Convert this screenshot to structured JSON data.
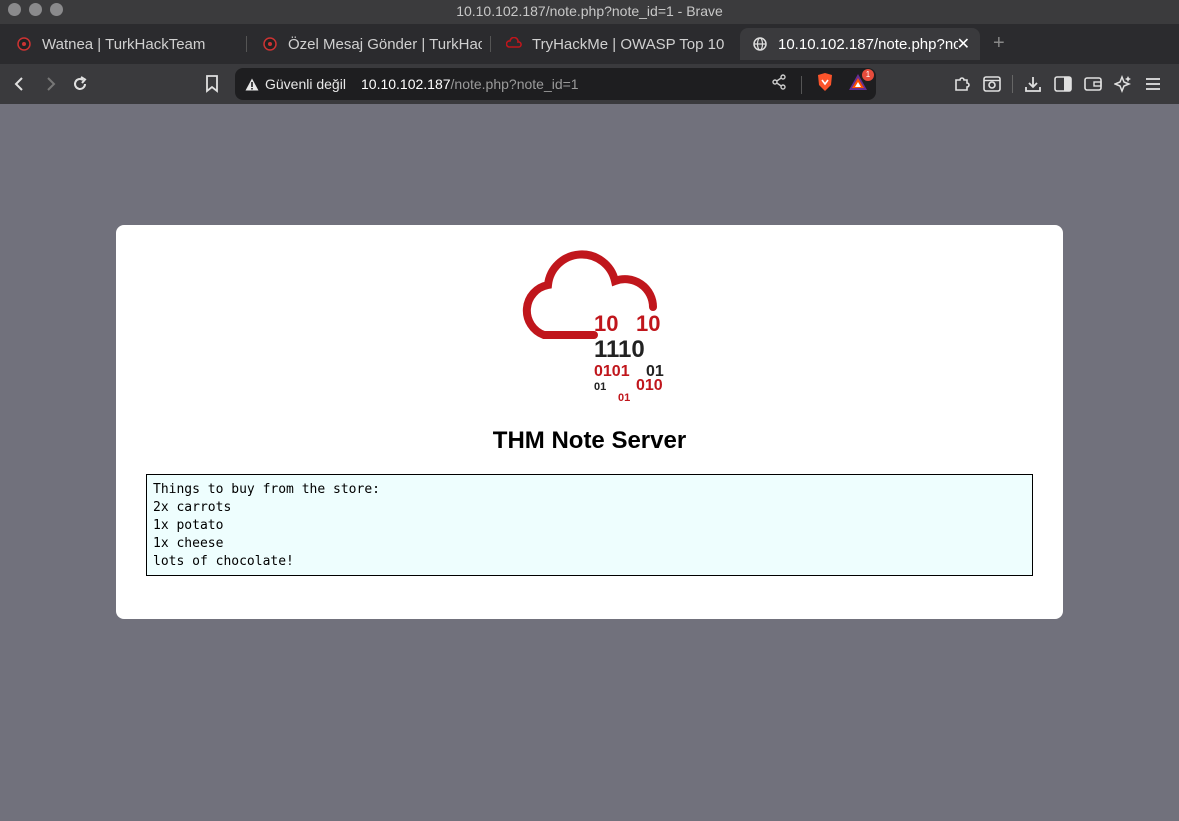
{
  "window": {
    "title": "10.10.102.187/note.php?note_id=1 - Brave"
  },
  "tabs": [
    {
      "label": "Watnea | TurkHackTeam",
      "icon": "turkhackteam-logo-icon"
    },
    {
      "label": "Özel Mesaj Gönder | TurkHack",
      "icon": "turkhackteam-logo-icon"
    },
    {
      "label": "TryHackMe | OWASP Top 10 -",
      "icon": "tryhackme-logo-icon"
    },
    {
      "label": "10.10.102.187/note.php?nc",
      "icon": "globe-icon",
      "active": true
    }
  ],
  "toolbar": {
    "security_label": "Güvenli değil",
    "url_host": "10.10.102.187",
    "url_path": "/note.php?note_id=1",
    "rewards_badge": "1"
  },
  "page": {
    "logo_digits": {
      "row1a": "10",
      "row1b": "10",
      "row2": "1110",
      "row3a": "0101",
      "row3b": "01",
      "row4a": "01",
      "row4b": "010",
      "row5": "01"
    },
    "title": "THM Note Server",
    "note_lines": [
      "Things to buy from the store:",
      "2x carrots",
      "1x potato",
      "1x cheese",
      "lots of chocolate!"
    ]
  },
  "colors": {
    "brand_red": "#c0161c",
    "page_bg": "#71717c",
    "note_bg": "#eefefe"
  }
}
